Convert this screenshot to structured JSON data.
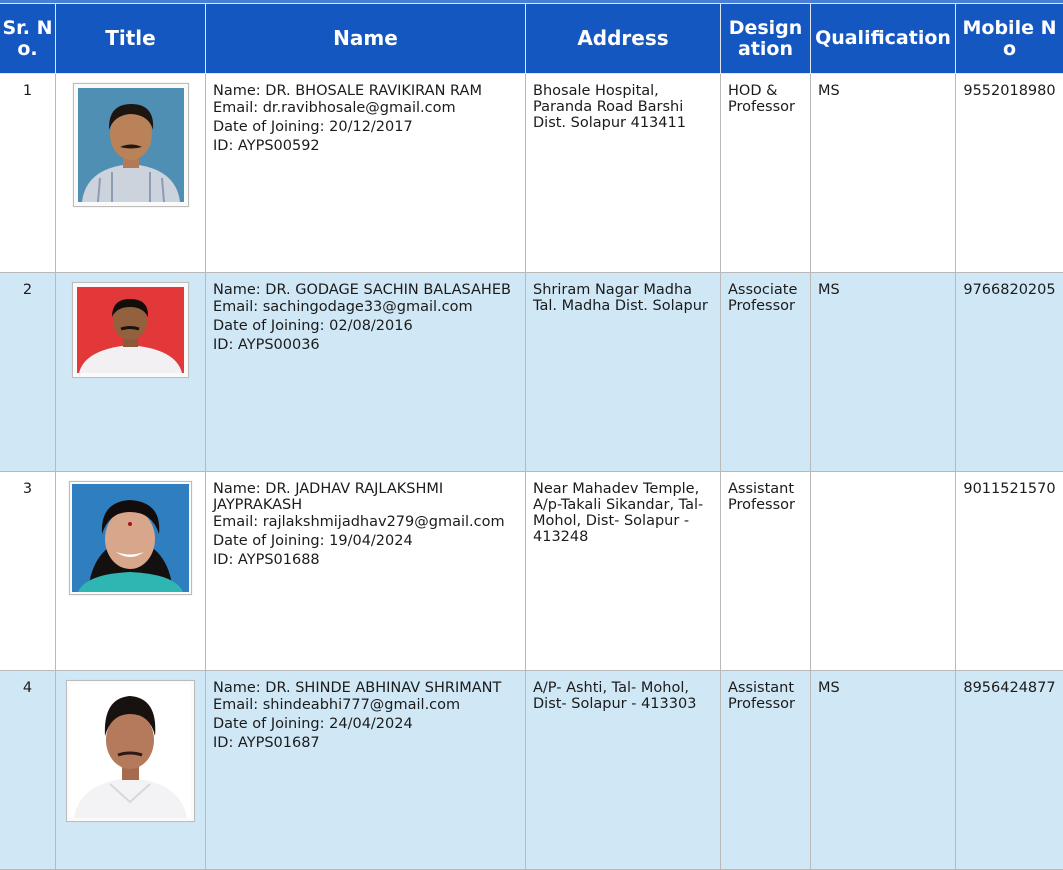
{
  "table": {
    "headers": [
      "Sr. No.",
      "Title",
      "Name",
      "Address",
      "Designation",
      "Qualification",
      "Mobile No"
    ],
    "rows": [
      {
        "sr": "1",
        "photo": "faculty-photo",
        "name": "Name: DR. BHOSALE RAVIKIRAN RAM",
        "email": "Email: dr.ravibhosale@gmail.com",
        "doj": "Date of Joining: 20/12/2017",
        "id": "ID: AYPS00592",
        "address": "Bhosale Hospital, Paranda Road Barshi Dist. Solapur 413411",
        "designation": "HOD & Professor",
        "qualification": "MS",
        "mobile": "9552018980"
      },
      {
        "sr": "2",
        "photo": "faculty-photo",
        "name": "Name: DR. GODAGE SACHIN BALASAHEB",
        "email": "Email: sachingodage33@gmail.com",
        "doj": "Date of Joining: 02/08/2016",
        "id": "ID: AYPS00036",
        "address": "Shriram Nagar Madha Tal. Madha Dist. Solapur",
        "designation": "Associate Professor",
        "qualification": "MS",
        "mobile": "9766820205"
      },
      {
        "sr": "3",
        "photo": "faculty-photo",
        "name": "Name: DR. JADHAV RAJLAKSHMI JAYPRAKASH",
        "email": "Email: rajlakshmijadhav279@gmail.com",
        "doj": "Date of Joining: 19/04/2024",
        "id": "ID: AYPS01688",
        "address": "Near Mahadev Temple, A/p-Takali Sikandar, Tal-Mohol, Dist- Solapur - 413248",
        "designation": "Assistant Professor",
        "qualification": "",
        "mobile": "9011521570"
      },
      {
        "sr": "4",
        "photo": "faculty-photo",
        "name": "Name: DR. SHINDE ABHINAV SHRIMANT",
        "email": "Email: shindeabhi777@gmail.com",
        "doj": "Date of Joining: 24/04/2024",
        "id": "ID: AYPS01687",
        "address": "A/P- Ashti, Tal- Mohol, Dist- Solapur - 413303",
        "designation": "Assistant Professor",
        "qualification": "MS",
        "mobile": "8956424877"
      }
    ]
  },
  "colors": {
    "header_bg": "#1557c0",
    "alt_row_bg": "#d0e8f5",
    "photo_bg_1": "#4f8fb3",
    "photo_bg_2": "#e3383a",
    "photo_bg_3": "#2f7fc0",
    "photo_bg_4": "#ffffff"
  }
}
